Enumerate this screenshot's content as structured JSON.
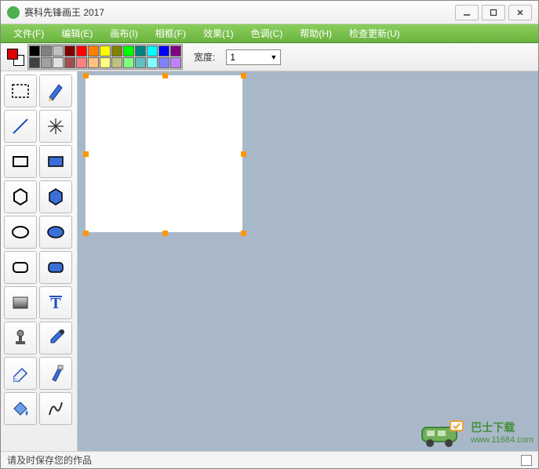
{
  "window": {
    "title": "赛科先锋画王 2017"
  },
  "menu": [
    "文件(F)",
    "编辑(E)",
    "画布(I)",
    "相框(F)",
    "效果(1)",
    "色调(C)",
    "帮助(H)",
    "检查更新(U)"
  ],
  "toolbar": {
    "width_label": "宽度:",
    "width_value": "1"
  },
  "palette_row1": [
    "#000000",
    "#808080",
    "#c0c0c0",
    "#800000",
    "#ff0000",
    "#ff8000",
    "#ffff00",
    "#808000",
    "#00ff00",
    "#008080",
    "#00ffff",
    "#0000ff",
    "#800080"
  ],
  "palette_row2": [
    "#404040",
    "#a0a0a0",
    "#e0e0e0",
    "#a05050",
    "#ff8080",
    "#ffc080",
    "#ffff80",
    "#c0c080",
    "#80ff80",
    "#60c0c0",
    "#80ffff",
    "#8080ff",
    "#c080ff"
  ],
  "colors": {
    "fg": "#d00000",
    "bg": "#ffffff"
  },
  "status": {
    "message": "请及时保存您的作品"
  },
  "watermark": {
    "name": "巴士下载",
    "url": "www.11684.com"
  }
}
